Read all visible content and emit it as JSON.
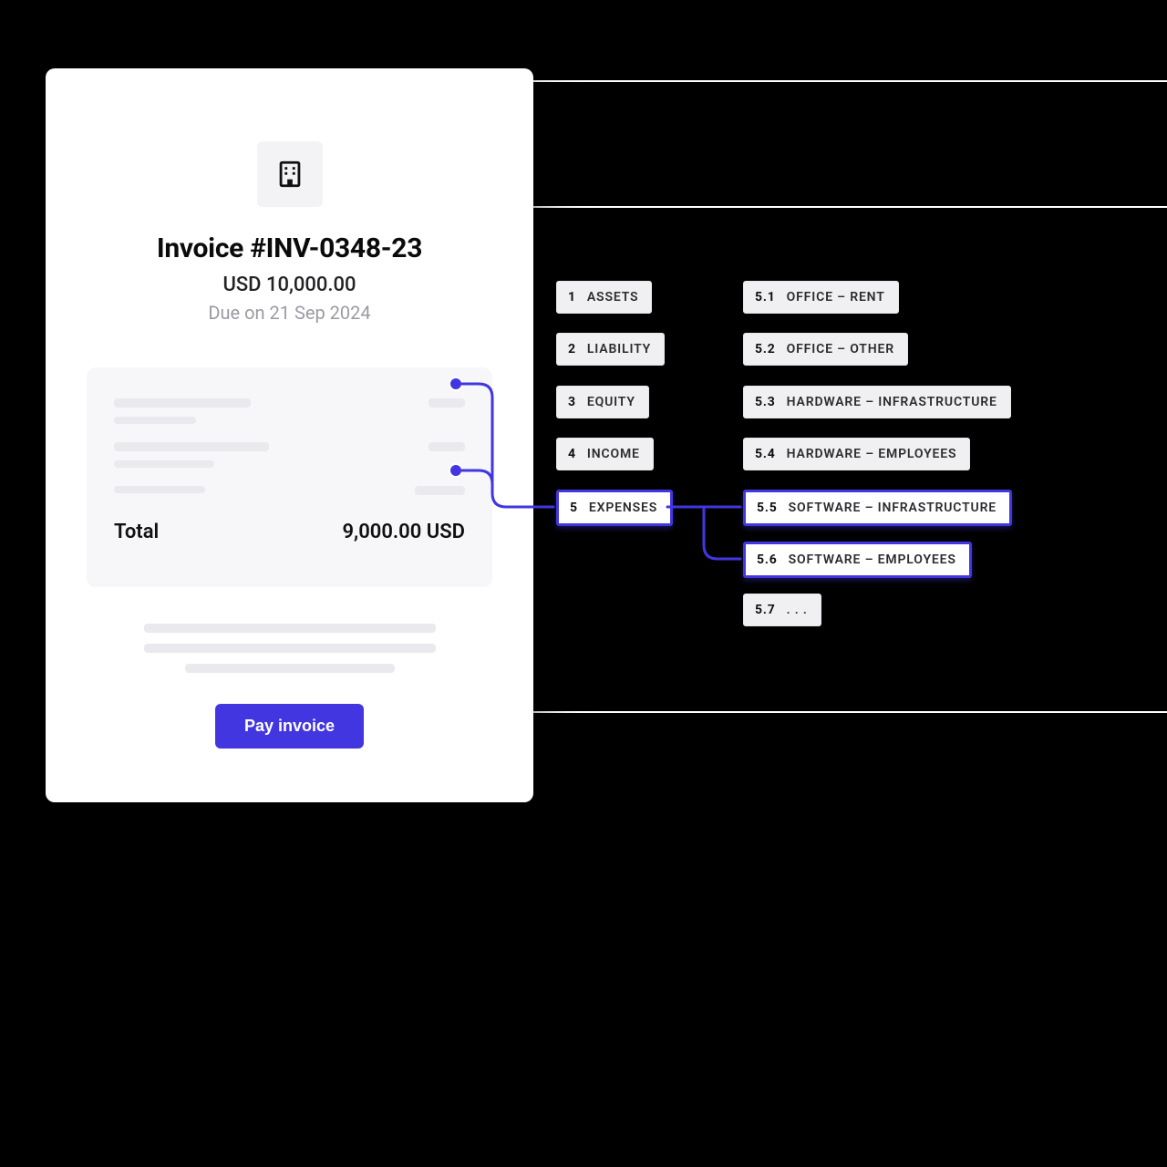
{
  "invoice": {
    "title": "Invoice #INV-0348-23",
    "amount": "USD 10,000.00",
    "due": "Due on 21 Sep 2024",
    "total_label": "Total",
    "total_value": "9,000.00 USD",
    "pay_label": "Pay invoice"
  },
  "accounts": {
    "primary": [
      {
        "num": "1",
        "label": "ASSETS"
      },
      {
        "num": "2",
        "label": "LIABILITY"
      },
      {
        "num": "3",
        "label": "EQUITY"
      },
      {
        "num": "4",
        "label": "INCOME"
      },
      {
        "num": "5",
        "label": "EXPENSES"
      }
    ],
    "secondary": [
      {
        "num": "5.1",
        "label": "OFFICE – RENT"
      },
      {
        "num": "5.2",
        "label": "OFFICE – OTHER"
      },
      {
        "num": "5.3",
        "label": "HARDWARE – INFRASTRUCTURE"
      },
      {
        "num": "5.4",
        "label": "HARDWARE – EMPLOYEES"
      },
      {
        "num": "5.5",
        "label": "SOFTWARE – INFRASTRUCTURE"
      },
      {
        "num": "5.6",
        "label": "SOFTWARE – EMPLOYEES"
      },
      {
        "num": "5.7",
        "label": ". . ."
      }
    ]
  },
  "colors": {
    "accent": "#4236e0"
  }
}
